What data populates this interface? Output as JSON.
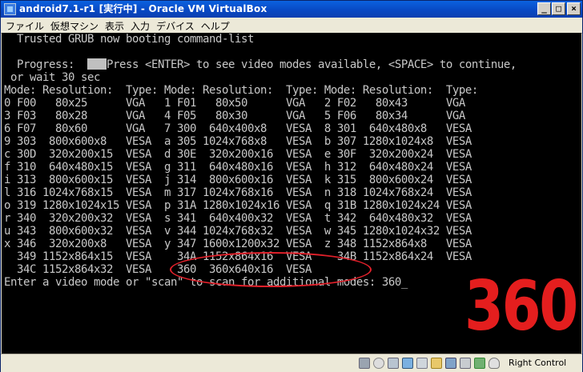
{
  "window": {
    "title": "android7.1-r1 [実行中] - Oracle VM VirtualBox"
  },
  "titlebar": {
    "minimize": "_",
    "maximize": "□",
    "close": "×"
  },
  "menubar": {
    "items": [
      "ファイル",
      "仮想マシン",
      "表示",
      "入力",
      "デバイス",
      "ヘルプ"
    ]
  },
  "terminal": {
    "line1": "  Trusted GRUB now booting command-list",
    "line2": "",
    "line3_prefix": "  Progress:  ",
    "line3_suffix": "Press <ENTER> to see video modes available, <SPACE> to continue,",
    "line4": " or wait 30 sec",
    "table_lines": [
      "Mode: Resolution:  Type: Mode: Resolution:  Type: Mode: Resolution:  Type:",
      "0 F00   80x25      VGA   1 F01   80x50      VGA   2 F02   80x43      VGA",
      "3 F03   80x28      VGA   4 F05   80x30      VGA   5 F06   80x34      VGA",
      "6 F07   80x60      VGA   7 300  640x400x8   VESA  8 301  640x480x8   VESA",
      "9 303  800x600x8   VESA  a 305 1024x768x8   VESA  b 307 1280x1024x8  VESA",
      "c 30D  320x200x15  VESA  d 30E  320x200x16  VESA  e 30F  320x200x24  VESA",
      "f 310  640x480x15  VESA  g 311  640x480x16  VESA  h 312  640x480x24  VESA",
      "i 313  800x600x15  VESA  j 314  800x600x16  VESA  k 315  800x600x24  VESA",
      "l 316 1024x768x15  VESA  m 317 1024x768x16  VESA  n 318 1024x768x24  VESA",
      "o 319 1280x1024x15 VESA  p 31A 1280x1024x16 VESA  q 31B 1280x1024x24 VESA",
      "r 340  320x200x32  VESA  s 341  640x400x32  VESA  t 342  640x480x32  VESA",
      "u 343  800x600x32  VESA  v 344 1024x768x32  VESA  w 345 1280x1024x32 VESA",
      "x 346  320x200x8   VESA  y 347 1600x1200x32 VESA  z 348 1152x864x8   VESA",
      "  349 1152x864x15  VESA    34A 1152x864x16  VESA    34B 1152x864x24  VESA",
      "  34C 1152x864x32  VESA    360  360x640x16  VESA"
    ],
    "prompt": "Enter a video mode or \"scan\" to scan for additional modes: 360_"
  },
  "annotation": {
    "big_text": "360",
    "color": "#e41e1e"
  },
  "statusbar": {
    "icons": [
      "hard-disk-icon",
      "optical-drive-icon",
      "audio-icon",
      "network-icon",
      "usb-icon",
      "shared-folder-icon",
      "display-icon",
      "video-capture-icon",
      "cpu-icon",
      "mouse-integration-icon",
      "host-key-icon"
    ],
    "host_key": "Right Control"
  }
}
